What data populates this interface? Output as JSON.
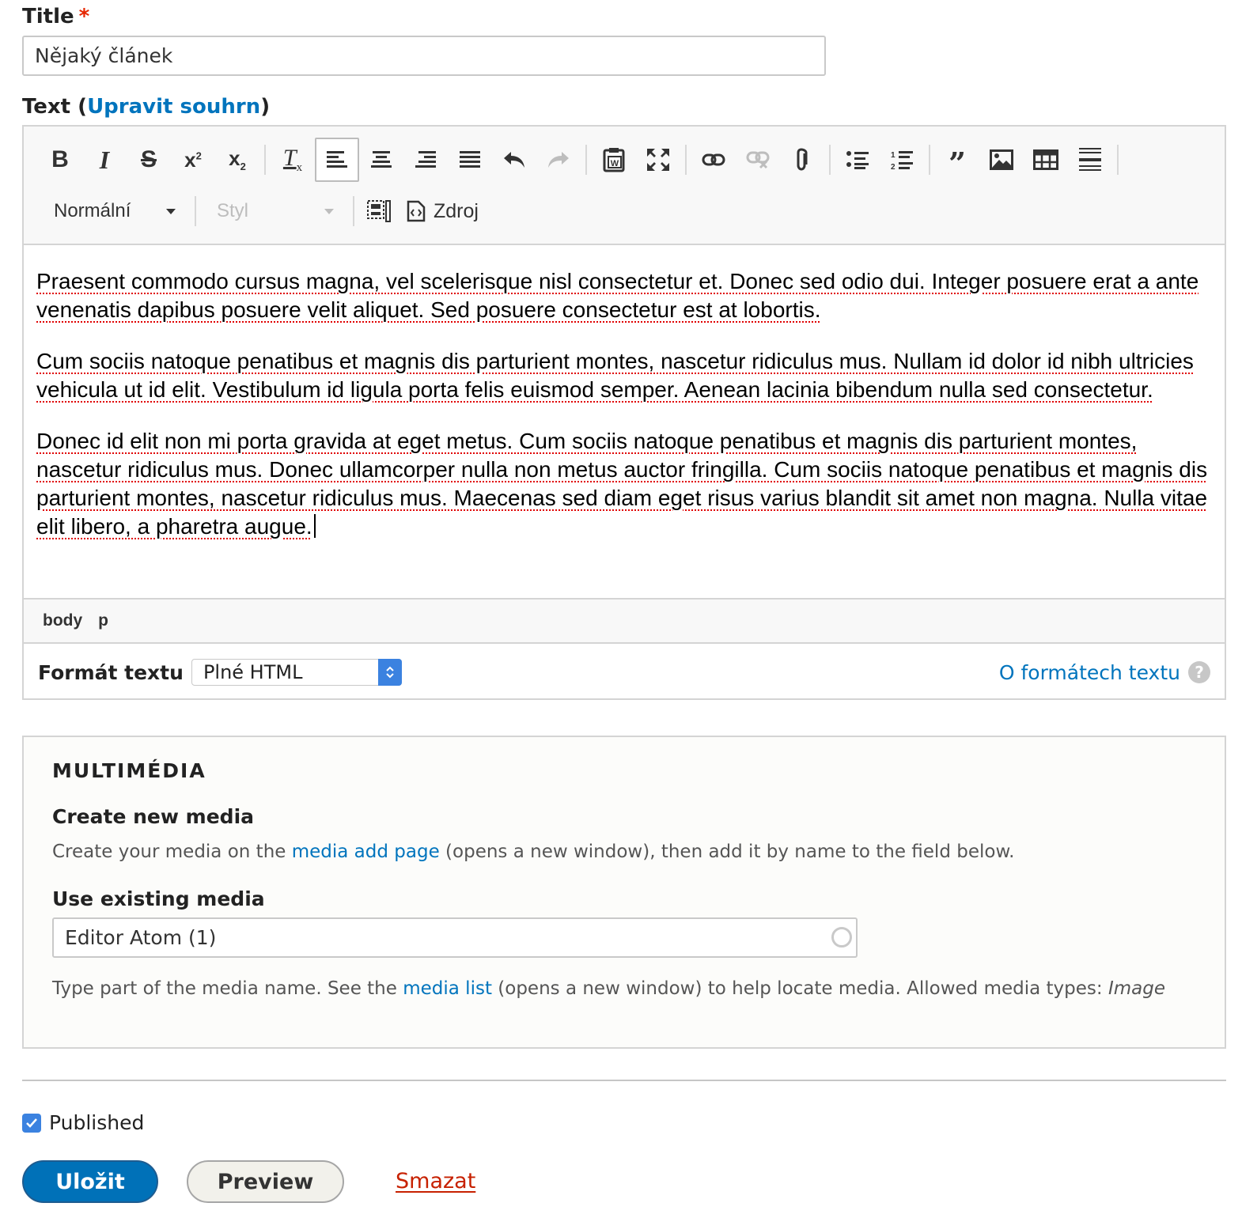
{
  "title_field": {
    "label": "Title",
    "required_mark": "*",
    "value": "Nějaký článek"
  },
  "text_field": {
    "label": "Text (",
    "summary_link": "Upravit souhrn",
    "label_close": ")"
  },
  "toolbar": {
    "row1": [
      {
        "name": "bold-icon",
        "glyph": "B"
      },
      {
        "name": "italic-icon",
        "glyph": "I"
      },
      {
        "name": "strikethrough-icon",
        "glyph": "S"
      },
      {
        "name": "superscript-icon",
        "glyph": "x²"
      },
      {
        "name": "subscript-icon",
        "glyph": "x₂"
      },
      {
        "name": "remove-format-icon",
        "glyph": "Tx"
      },
      {
        "name": "align-left-icon",
        "glyph": ""
      },
      {
        "name": "align-center-icon",
        "glyph": ""
      },
      {
        "name": "align-right-icon",
        "glyph": ""
      },
      {
        "name": "align-justify-icon",
        "glyph": ""
      },
      {
        "name": "undo-icon",
        "glyph": ""
      },
      {
        "name": "redo-icon",
        "glyph": ""
      },
      {
        "name": "paste-from-word-icon",
        "glyph": ""
      },
      {
        "name": "maximize-icon",
        "glyph": ""
      },
      {
        "name": "link-icon",
        "glyph": ""
      },
      {
        "name": "unlink-icon",
        "glyph": ""
      },
      {
        "name": "attachment-icon",
        "glyph": ""
      },
      {
        "name": "bulleted-list-icon",
        "glyph": ""
      },
      {
        "name": "numbered-list-icon",
        "glyph": ""
      },
      {
        "name": "blockquote-icon",
        "glyph": "❞"
      },
      {
        "name": "image-icon",
        "glyph": ""
      },
      {
        "name": "table-icon",
        "glyph": ""
      },
      {
        "name": "horizontal-rule-icon",
        "glyph": ""
      }
    ],
    "format_combo": "Normální",
    "style_combo": "Styl",
    "source_label": "Zdroj"
  },
  "editor_content": {
    "paragraphs": [
      "Praesent commodo cursus magna, vel scelerisque nisl consectetur et. Donec sed odio dui. Integer posuere erat a ante venenatis dapibus posuere velit aliquet. Sed posuere consectetur est at lobortis.",
      "Cum sociis natoque penatibus et magnis dis parturient montes, nascetur ridiculus mus. Nullam id dolor id nibh ultricies vehicula ut id elit. Vestibulum id ligula porta felis euismod semper. Aenean lacinia bibendum nulla sed consectetur.",
      "Donec id elit non mi porta gravida at eget metus. Cum sociis natoque penatibus et magnis dis parturient montes, nascetur ridiculus mus. Donec ullamcorper nulla non metus auctor fringilla. Cum sociis natoque penatibus et magnis dis parturient montes, nascetur ridiculus mus. Maecenas sed diam eget risus varius blandit sit amet non magna. Nulla vitae elit libero, a pharetra augue."
    ]
  },
  "pathbar": [
    "body",
    "p"
  ],
  "text_format": {
    "label": "Formát textu",
    "selected": "Plné HTML",
    "help_link": "O formátech textu",
    "help_icon": "?"
  },
  "media": {
    "heading": "MULTIMÉDIA",
    "create_title": "Create new media",
    "create_desc_pre": "Create your media on the ",
    "create_desc_link": "media add page",
    "create_desc_post": " (opens a new window), then add it by name to the field below.",
    "existing_title": "Use existing media",
    "existing_value": "Editor Atom (1)",
    "help_pre": "Type part of the media name. See the ",
    "help_link": "media list",
    "help_post": " (opens a new window) to help locate media. Allowed media types: ",
    "help_types": "Image"
  },
  "published": {
    "label": "Published",
    "checked": true
  },
  "actions": {
    "save": "Uložit",
    "preview": "Preview",
    "delete": "Smazat"
  },
  "colors": {
    "link": "#0074bd",
    "primary_button": "#0071b8",
    "delete": "#c72100",
    "required": "#e62600",
    "spellcheck": "#e00000"
  }
}
